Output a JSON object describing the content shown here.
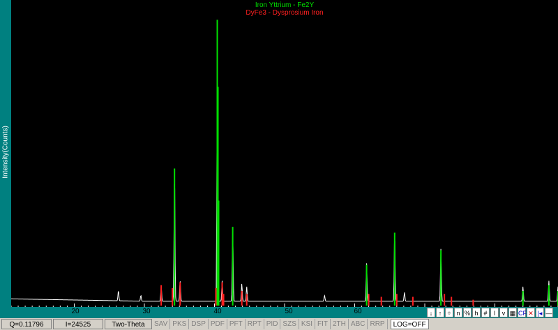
{
  "chart": {
    "legend_top": "Iron Yttrium - Fe2Y",
    "legend_bottom": "DyFe3 - Dysprosium Iron",
    "ylabel": "Intensity(Counts)",
    "x_ticks": [
      "20",
      "30",
      "40",
      "50",
      "60"
    ]
  },
  "colors": {
    "background": "#000000",
    "axis": "#008080",
    "pattern_1": "#00e000",
    "pattern_2": "#ff2020",
    "measured": "#ffffff"
  },
  "chart_data": {
    "type": "line",
    "xlabel": "",
    "ylabel": "Intensity(Counts)",
    "xlim": [
      11,
      89
    ],
    "ylim": [
      0,
      1
    ],
    "x_ticks": [
      20,
      30,
      40,
      50,
      60
    ],
    "series": [
      {
        "name": "Iron Yttrium - Fe2Y",
        "style": "stick",
        "peaks": [
          {
            "x": 34.3,
            "y": 0.47
          },
          {
            "x": 40.4,
            "y": 0.98
          },
          {
            "x": 40.5,
            "y": 0.75
          },
          {
            "x": 40.6,
            "y": 0.36
          },
          {
            "x": 42.6,
            "y": 0.27
          },
          {
            "x": 61.7,
            "y": 0.14
          },
          {
            "x": 65.7,
            "y": 0.25
          },
          {
            "x": 72.3,
            "y": 0.19
          },
          {
            "x": 84.0,
            "y": 0.05
          },
          {
            "x": 87.7,
            "y": 0.07
          },
          {
            "x": 89.0,
            "y": 0.05
          }
        ]
      },
      {
        "name": "DyFe3 - Dysprosium Iron",
        "style": "stick",
        "peaks": [
          {
            "x": 32.4,
            "y": 0.07
          },
          {
            "x": 34.0,
            "y": 0.06
          },
          {
            "x": 35.1,
            "y": 0.08
          },
          {
            "x": 40.2,
            "y": 0.06
          },
          {
            "x": 41.1,
            "y": 0.08
          },
          {
            "x": 41.3,
            "y": 0.04
          },
          {
            "x": 43.9,
            "y": 0.05
          },
          {
            "x": 44.6,
            "y": 0.04
          },
          {
            "x": 62.0,
            "y": 0.04
          },
          {
            "x": 63.8,
            "y": 0.03
          },
          {
            "x": 66.0,
            "y": 0.04
          },
          {
            "x": 68.3,
            "y": 0.03
          },
          {
            "x": 72.8,
            "y": 0.04
          },
          {
            "x": 73.8,
            "y": 0.03
          },
          {
            "x": 76.9,
            "y": 0.02
          }
        ]
      },
      {
        "name": "",
        "style": "profile",
        "baseline": 0.015,
        "peaks": [
          {
            "x": 26.3,
            "y": 0.035
          },
          {
            "x": 29.5,
            "y": 0.02
          },
          {
            "x": 32.4,
            "y": 0.05
          },
          {
            "x": 34.3,
            "y": 0.45
          },
          {
            "x": 35.1,
            "y": 0.07
          },
          {
            "x": 40.4,
            "y": 0.74
          },
          {
            "x": 41.1,
            "y": 0.07
          },
          {
            "x": 42.6,
            "y": 0.25
          },
          {
            "x": 43.9,
            "y": 0.06
          },
          {
            "x": 44.6,
            "y": 0.05
          },
          {
            "x": 55.7,
            "y": 0.02
          },
          {
            "x": 61.7,
            "y": 0.13
          },
          {
            "x": 65.7,
            "y": 0.23
          },
          {
            "x": 67.1,
            "y": 0.03
          },
          {
            "x": 72.3,
            "y": 0.18
          },
          {
            "x": 84.0,
            "y": 0.05
          },
          {
            "x": 87.7,
            "y": 0.07
          },
          {
            "x": 89.0,
            "y": 0.05
          }
        ]
      }
    ]
  },
  "toolbar": {
    "buttons": [
      "↓",
      "↑",
      "÷",
      "n",
      "%",
      "h",
      "#",
      "l",
      "v",
      "▦",
      "CF",
      "✕",
      "|◂",
      "—"
    ]
  },
  "status": {
    "q_value": "Q=0.11796",
    "i_value": "I=24525",
    "mode": "Two-Theta",
    "buttons": [
      "SAV",
      "PKS",
      "DSP",
      "PDF",
      "PFT",
      "RPT",
      "PID",
      "SZS",
      "KSI",
      "FIT",
      "2TH",
      "ABC",
      "RRP"
    ],
    "log": "LOG=OFF"
  }
}
